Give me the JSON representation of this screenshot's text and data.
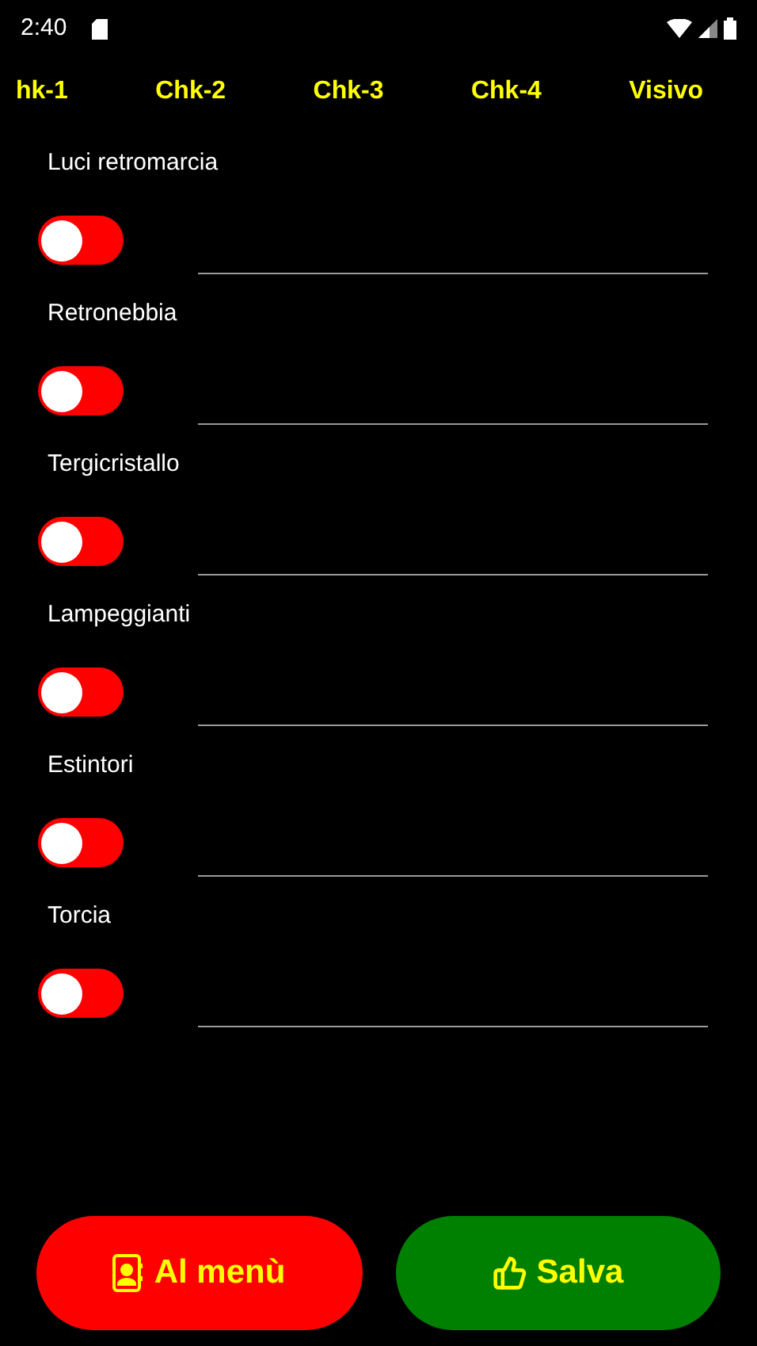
{
  "status_bar": {
    "time": "2:40"
  },
  "tabs": [
    {
      "label": "hk-1"
    },
    {
      "label": "Chk-2"
    },
    {
      "label": "Chk-3"
    },
    {
      "label": "Chk-4"
    },
    {
      "label": "Visivo"
    }
  ],
  "items": [
    {
      "label": "Luci retromarcia",
      "on": false
    },
    {
      "label": "Retronebbia",
      "on": false
    },
    {
      "label": "Tergicristallo",
      "on": false
    },
    {
      "label": "Lampeggianti",
      "on": false
    },
    {
      "label": "Estintori",
      "on": false
    },
    {
      "label": "Torcia",
      "on": false
    }
  ],
  "buttons": [
    {
      "kind": "menu",
      "label": "Al menù"
    },
    {
      "kind": "save",
      "label": "Salva"
    }
  ]
}
